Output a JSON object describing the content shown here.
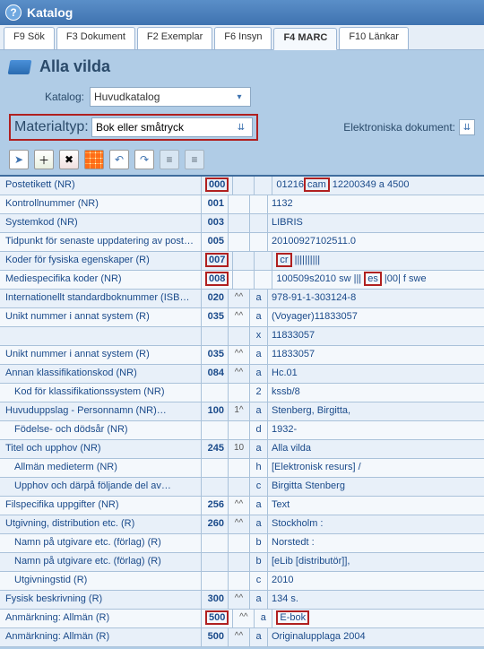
{
  "window": {
    "title": "Katalog"
  },
  "tabs": [
    {
      "label": "F9 Sök"
    },
    {
      "label": "F3 Dokument"
    },
    {
      "label": "F2 Exemplar"
    },
    {
      "label": "F6 Insyn"
    },
    {
      "label": "F4 MARC"
    },
    {
      "label": "F10 Länkar"
    }
  ],
  "header": {
    "title": "Alla vilda"
  },
  "form": {
    "katalog_label": "Katalog:",
    "katalog_value": "Huvudkatalog",
    "material_label": "Materialtyp:",
    "material_value": "Bok eller småtryck",
    "elec_label": "Elektroniska dokument:"
  },
  "rows": [
    {
      "label": "Postetikett (NR)",
      "tag": "000",
      "tag_hl": true,
      "ind": "",
      "sub": "",
      "val": "01216",
      "val2": "cam",
      "val2_hl": true,
      "val3": " 12200349 a 4500"
    },
    {
      "label": "Kontrollnummer (NR)",
      "tag": "001",
      "ind": "",
      "sub": "",
      "val": "1132"
    },
    {
      "label": "Systemkod (NR)",
      "tag": "003",
      "ind": "",
      "sub": "",
      "val": "LIBRIS"
    },
    {
      "label": "Tidpunkt för senaste uppdatering av posten…",
      "tag": "005",
      "ind": "",
      "sub": "",
      "val": "20100927102511.0"
    },
    {
      "label": "Koder för fysiska egenskaper (R)",
      "tag": "007",
      "tag_hl": true,
      "ind": "",
      "sub": "",
      "val": "cr",
      "val_hl": true,
      "val3": " ||||||||||"
    },
    {
      "label": "Mediespecifika koder (NR)",
      "tag": "008",
      "tag_hl": true,
      "ind": "",
      "sub": "",
      "val": "100509s2010    sw ||| ",
      "val2": "es",
      "val2_hl": true,
      "val3": "  |00| f swe"
    },
    {
      "label": "Internationellt standardboknummer (ISBN)…",
      "tag": "020",
      "ind": "^^",
      "sub": "a",
      "val": "978-91-1-303124-8"
    },
    {
      "label": "Unikt nummer i annat system (R)",
      "tag": "035",
      "ind": "^^",
      "sub": "a",
      "val": "(Voyager)11833057"
    },
    {
      "label": "",
      "tag": "",
      "ind": "",
      "sub": "x",
      "val": "11833057"
    },
    {
      "label": "Unikt nummer i annat system (R)",
      "tag": "035",
      "ind": "^^",
      "sub": "a",
      "val": "11833057"
    },
    {
      "label": "Annan klassifikationskod (NR)",
      "tag": "084",
      "ind": "^^",
      "sub": "a",
      "val": "Hc.01"
    },
    {
      "label": "Kod för klassifikationssystem (NR)",
      "indent": true,
      "tag": "",
      "ind": "",
      "sub": "2",
      "val": "kssb/8"
    },
    {
      "label": "Huvuduppslag - Personnamn (NR)…",
      "tag": "100",
      "ind": "1^",
      "sub": "a",
      "val": "Stenberg, Birgitta,"
    },
    {
      "label": "Födelse- och dödsår (NR)",
      "indent": true,
      "tag": "",
      "ind": "",
      "sub": "d",
      "val": "1932-"
    },
    {
      "label": "Titel och upphov (NR)",
      "tag": "245",
      "ind": "10",
      "sub": "a",
      "val": "Alla vilda"
    },
    {
      "label": "Allmän medieterm (NR)",
      "indent": true,
      "tag": "",
      "ind": "",
      "sub": "h",
      "val": "[Elektronisk resurs] /"
    },
    {
      "label": "Upphov och därpå följande del av…",
      "indent": true,
      "tag": "",
      "ind": "",
      "sub": "c",
      "val": "Birgitta Stenberg"
    },
    {
      "label": "Filspecifika uppgifter (NR)",
      "tag": "256",
      "ind": "^^",
      "sub": "a",
      "val": "Text"
    },
    {
      "label": "Utgivning, distribution etc. (R)",
      "tag": "260",
      "ind": "^^",
      "sub": "a",
      "val": "Stockholm :"
    },
    {
      "label": "Namn på utgivare etc. (förlag) (R)",
      "indent": true,
      "tag": "",
      "ind": "",
      "sub": "b",
      "val": "Norstedt :"
    },
    {
      "label": "Namn på utgivare etc. (förlag) (R)",
      "indent": true,
      "tag": "",
      "ind": "",
      "sub": "b",
      "val": "[eLib [distributör]],"
    },
    {
      "label": "Utgivningstid (R)",
      "indent": true,
      "tag": "",
      "ind": "",
      "sub": "c",
      "val": "2010"
    },
    {
      "label": "Fysisk beskrivning (R)",
      "tag": "300",
      "ind": "^^",
      "sub": "a",
      "val": "134 s."
    },
    {
      "label": "Anmärkning: Allmän (R)",
      "tag": "500",
      "tag_hl": true,
      "ind": "^^",
      "sub": "a",
      "val": "E-bok",
      "val_hl": true
    },
    {
      "label": "Anmärkning: Allmän (R)",
      "tag": "500",
      "ind": "^^",
      "sub": "a",
      "val": "Originalupplaga 2004"
    }
  ]
}
